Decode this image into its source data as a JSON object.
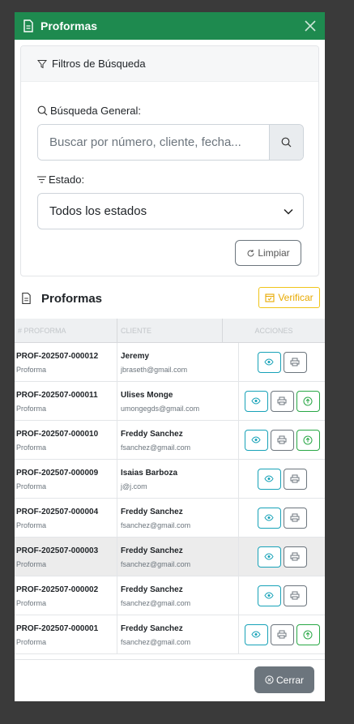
{
  "modal": {
    "title": "Proformas"
  },
  "filters": {
    "title": "Filtros de Búsqueda",
    "search_label": "Búsqueda General:",
    "search_placeholder": "Buscar por número, cliente, fecha...",
    "estado_label": "Estado:",
    "estado_value": "Todos los estados",
    "clear_label": "Limpiar"
  },
  "list": {
    "title": "Proformas",
    "verify_label": "Verificar",
    "columns": [
      "# PROFORMA",
      "CLIENTE",
      "ACCIONES"
    ],
    "rows": [
      {
        "number": "PROF-202507-000012",
        "type": "Proforma",
        "client": "Jeremy",
        "email": "jbraseth@gmail.com",
        "actions": [
          "view",
          "print"
        ]
      },
      {
        "number": "PROF-202507-000011",
        "type": "Proforma",
        "client": "Ulises Monge",
        "email": "umongegds@gmail.com",
        "actions": [
          "view",
          "print",
          "upload"
        ]
      },
      {
        "number": "PROF-202507-000010",
        "type": "Proforma",
        "client": "Freddy Sanchez",
        "email": "fsanchez@gmail.com",
        "actions": [
          "view",
          "print",
          "upload"
        ]
      },
      {
        "number": "PROF-202507-000009",
        "type": "Proforma",
        "client": "Isaias Barboza",
        "email": "j@j.com",
        "actions": [
          "view",
          "print"
        ]
      },
      {
        "number": "PROF-202507-000004",
        "type": "Proforma",
        "client": "Freddy Sanchez",
        "email": "fsanchez@gmail.com",
        "actions": [
          "view",
          "print"
        ]
      },
      {
        "number": "PROF-202507-000003",
        "type": "Proforma",
        "client": "Freddy Sanchez",
        "email": "fsanchez@gmail.com",
        "actions": [
          "view",
          "print"
        ],
        "highlighted": true
      },
      {
        "number": "PROF-202507-000002",
        "type": "Proforma",
        "client": "Freddy Sanchez",
        "email": "fsanchez@gmail.com",
        "actions": [
          "view",
          "print"
        ]
      },
      {
        "number": "PROF-202507-000001",
        "type": "Proforma",
        "client": "Freddy Sanchez",
        "email": "fsanchez@gmail.com",
        "actions": [
          "view",
          "print",
          "upload"
        ]
      }
    ]
  },
  "footer": {
    "close_label": "Cerrar"
  },
  "colors": {
    "header": "#1e8a4f",
    "view": "#17a2b8",
    "print": "#6c757d",
    "upload": "#28a745",
    "verify": "#f0c419"
  }
}
